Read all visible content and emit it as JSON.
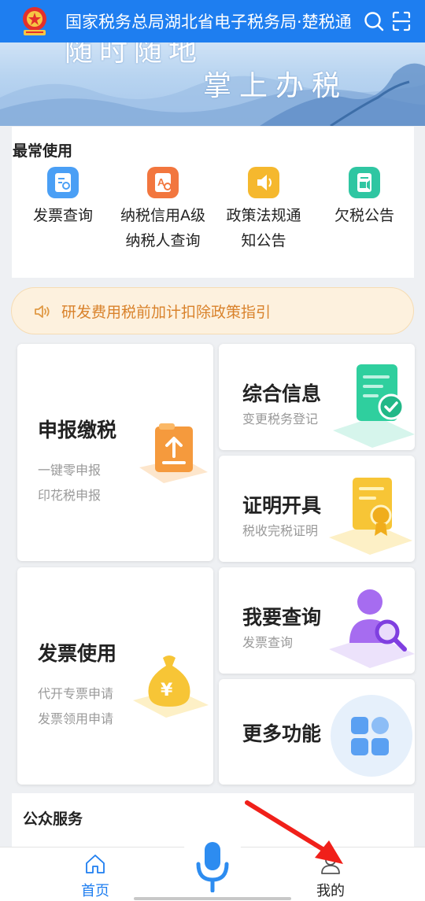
{
  "header": {
    "title": "国家税务总局湖北省电子税务局·楚税通",
    "emblem_icon": "national-emblem-icon",
    "search_icon": "search-icon",
    "scan_icon": "scan-icon",
    "bg_color": "#1e7ef0"
  },
  "banner": {
    "line1": "随时随地",
    "line2": "掌上办税"
  },
  "common": {
    "title": "最常使用",
    "items": [
      {
        "label": "发票查询",
        "icon": "invoice-search-icon",
        "color": "#4a9ff5"
      },
      {
        "label": "纳税信用A级纳税人查询",
        "icon": "credit-search-icon",
        "color": "#f2763e"
      },
      {
        "label": "政策法规通知公告",
        "icon": "announcement-icon",
        "color": "#f5b82e"
      },
      {
        "label": "欠税公告",
        "icon": "tax-notice-icon",
        "color": "#2fc6a2"
      }
    ]
  },
  "notice": {
    "text": "研发费用税前加计扣除政策指引",
    "icon": "speaker-icon"
  },
  "features": {
    "declare": {
      "title": "申报缴税",
      "sub1": "一键零申报",
      "sub2": "印花税申报"
    },
    "info": {
      "title": "综合信息",
      "sub": "变更税务登记"
    },
    "certificate": {
      "title": "证明开具",
      "sub": "税收完税证明"
    },
    "invoice": {
      "title": "发票使用",
      "sub1": "代开专票申请",
      "sub2": "发票领用申请"
    },
    "query": {
      "title": "我要查询",
      "sub": "发票查询"
    },
    "more": {
      "title": "更多功能"
    }
  },
  "public": {
    "title": "公众服务"
  },
  "bottom_nav": {
    "home": "首页",
    "mine": "我的",
    "active_color": "#1e7ef0"
  }
}
